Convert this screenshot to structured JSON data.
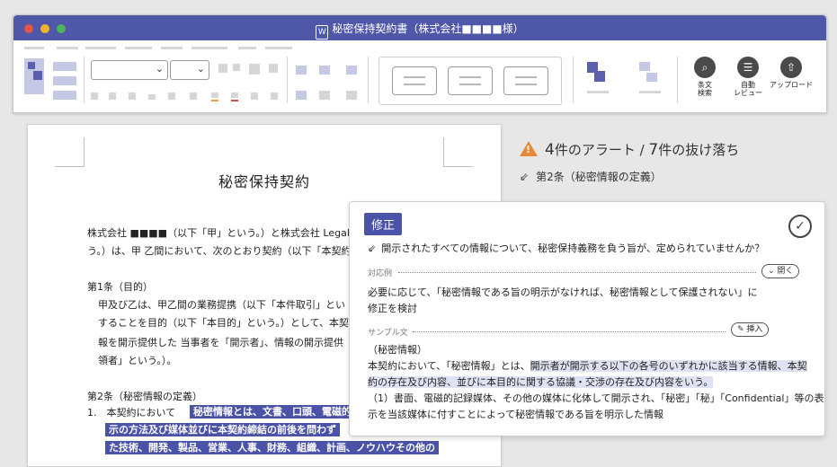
{
  "window": {
    "title": "秘密保持契約書（株式会社■■■■様）",
    "dot_colors": [
      "#e2574c",
      "#f2b230",
      "#4cb45a"
    ]
  },
  "toolbar": {
    "style_labels": [
      "",
      "",
      ""
    ],
    "tools": [
      {
        "icon": "search-icon",
        "label_line1": "条文",
        "label_line2": "検索"
      },
      {
        "icon": "review-icon",
        "label_line1": "自動",
        "label_line2": "レビュー"
      },
      {
        "icon": "upload-icon",
        "label_line1": "アップロード",
        "label_line2": ""
      }
    ]
  },
  "document": {
    "title": "秘密保持契約",
    "lines": [
      "株式会社 ■■■■（以下「甲」という。）と株式会社 LegalF",
      "う。）は、甲 乙間において、次のとおり契約（以下「本契約」",
      "第1条（目的）",
      "甲及び乙は、甲乙間の業務提携（以下「本件取引」とい",
      "することを目的（以下「本目的」という。）として、本契約",
      "報を開示提供した 当事者を「開示者」、情報の開示提供",
      "領者」という。）。",
      "第2条（秘密情報の定義）",
      "1.　本契約において",
      "秘密情報とは、文書、口頭、電磁的",
      "示の方法及び媒体並びに本契約締結の前後を問わず",
      "た技術、開発、製品、営業、人事、財務、組織、計画、ノウハウその他の"
    ]
  },
  "panel": {
    "alert_count": "4",
    "alert_text": "件のアラート / ",
    "missing_count": "7",
    "missing_text": "件の抜け落ち",
    "clause_title": "第2条（秘密情報の定義）",
    "card": {
      "badge": "修正",
      "question": "開示されたすべての情報について、秘密保持義務を負う旨が、定められていませんか？",
      "response_label": "対応例",
      "open_button": "開く",
      "response_line1": "必要に応じて、「秘密情報である旨の明示がなければ、秘密情報として保護されない」に",
      "response_line2": "修正を検討",
      "sample_label": "サンプル文",
      "insert_button": "挿入",
      "sample_heading": "（秘密情報）",
      "sample_line1_plain": "本契約において、「秘密情報」とは、",
      "sample_line1_hl": "開示者が開示する以下の各号のいずれかに該当する情報、本契",
      "sample_line2_hl": "約の存在及び内容、並びに本目的に関する協議・交渉の存在及び内容をいう。",
      "sample_line3": "（1）書面、電磁的記録媒体、その他の媒体に化体して開示され、「秘密」「秘」「Confidential」等の表",
      "sample_line4": "示を当該媒体に付すことによって秘密情報である旨を明示した情報"
    }
  },
  "colors": {
    "brand": "#4f57a8",
    "highlight": "#4b53a8",
    "alert": "#e8893a"
  }
}
